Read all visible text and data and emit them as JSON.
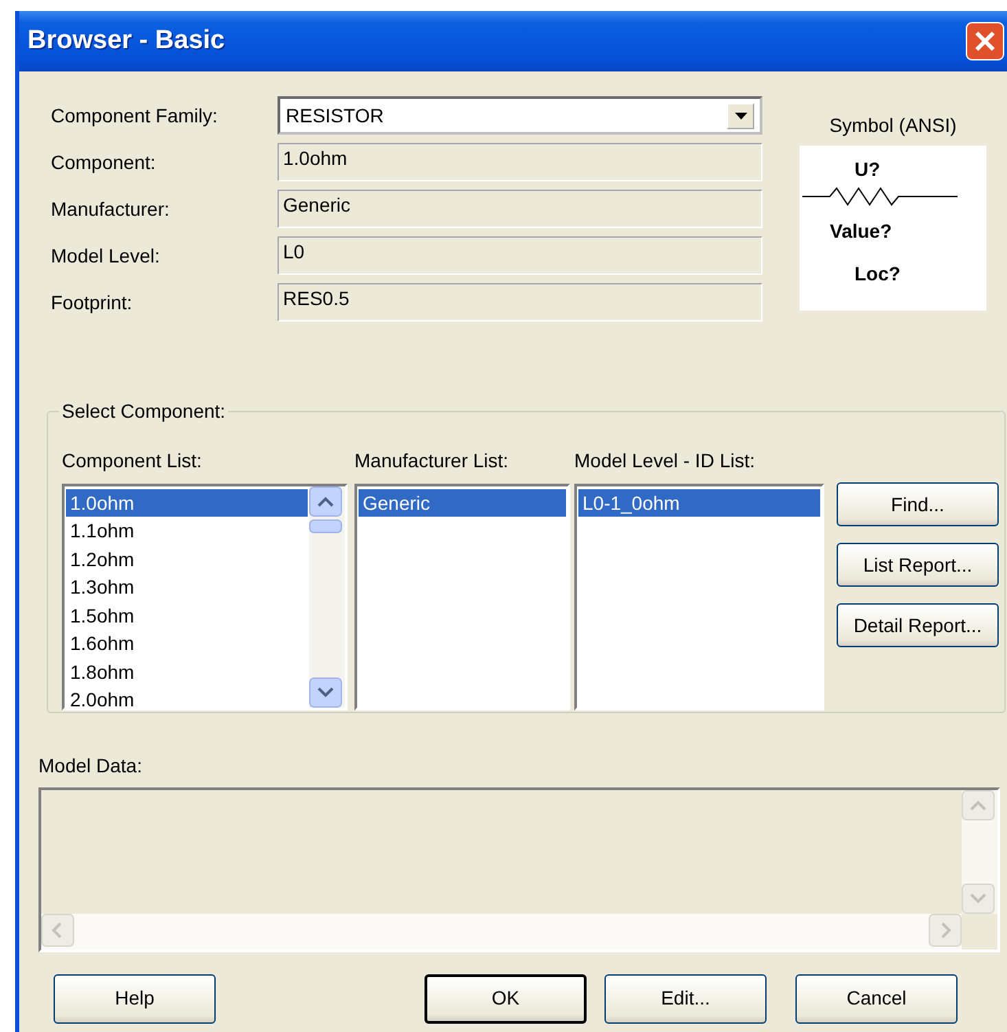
{
  "window": {
    "title": "Browser - Basic"
  },
  "fields": [
    {
      "kind": "dropdown",
      "label": "Component Family:",
      "value": "RESISTOR"
    },
    {
      "kind": "readonly",
      "label": "Component:",
      "value": "1.0ohm"
    },
    {
      "kind": "readonly",
      "label": "Manufacturer:",
      "value": "Generic"
    },
    {
      "kind": "readonly",
      "label": "Model Level:",
      "value": "L0"
    },
    {
      "kind": "readonly",
      "label": "Footprint:",
      "value": "RES0.5"
    }
  ],
  "symbol": {
    "label": "Symbol (ANSI)",
    "designator": "U?",
    "value": "Value?",
    "location": "Loc?"
  },
  "select_component": {
    "title": "Select Component:",
    "lists": [
      {
        "label": "Component List:",
        "scrollbar": true,
        "items": [
          {
            "text": "1.0ohm",
            "selected": true
          },
          {
            "text": "1.1ohm",
            "selected": false
          },
          {
            "text": "1.2ohm",
            "selected": false
          },
          {
            "text": "1.3ohm",
            "selected": false
          },
          {
            "text": "1.5ohm",
            "selected": false
          },
          {
            "text": "1.6ohm",
            "selected": false
          },
          {
            "text": "1.8ohm",
            "selected": false
          },
          {
            "text": "2.0ohm",
            "selected": false
          }
        ]
      },
      {
        "label": "Manufacturer List:",
        "scrollbar": false,
        "items": [
          {
            "text": "Generic",
            "selected": true
          }
        ]
      },
      {
        "label": "Model Level - ID List:",
        "scrollbar": false,
        "items": [
          {
            "text": "L0-1_0ohm",
            "selected": true
          }
        ]
      }
    ],
    "buttons": [
      "Find...",
      "List Report...",
      "Detail Report..."
    ]
  },
  "model_data": {
    "label": "Model Data:"
  },
  "buttons": [
    {
      "label": "Help",
      "default": false
    },
    {
      "label": "OK",
      "default": true
    },
    {
      "label": "Edit...",
      "default": false
    },
    {
      "label": "Cancel",
      "default": false
    }
  ]
}
